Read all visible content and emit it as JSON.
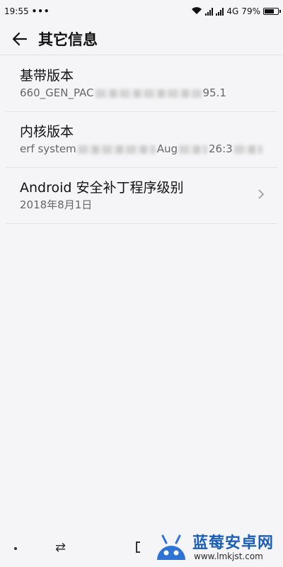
{
  "status_bar": {
    "time": "19:55",
    "dots": "•••",
    "network": "4G",
    "battery_pct": "79%",
    "battery_level": 0.79
  },
  "header": {
    "title": "其它信息",
    "back_icon": "arrow-left-icon"
  },
  "items": [
    {
      "title": "基带版本",
      "value_prefix": "660_GEN_PAC",
      "value_suffix": "95.1",
      "has_chevron": false
    },
    {
      "title": "内核版本",
      "value_prefix": "erf system",
      "value_mid": "Aug",
      "value_suffix": "26:3",
      "has_chevron": false
    },
    {
      "title": "Android 安全补丁程序级别",
      "value": "2018年8月1日",
      "has_chevron": true
    }
  ],
  "nav_bar": {
    "icons": [
      "dot-icon",
      "swap-icon",
      "home-icon"
    ]
  },
  "watermark": {
    "brand": "蓝莓安卓网",
    "url": "www.lmkjst.com",
    "colors": {
      "text": "#1c5fb8",
      "logo": "#2e73d6"
    }
  }
}
